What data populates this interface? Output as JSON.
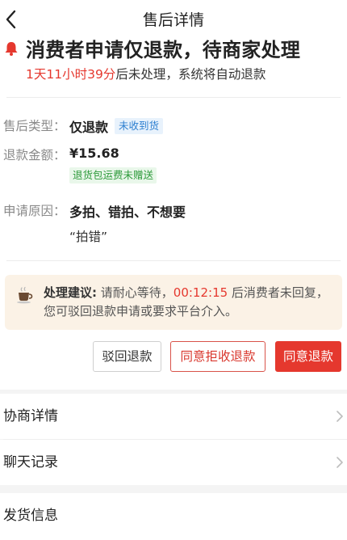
{
  "nav": {
    "title": "售后详情"
  },
  "status": {
    "title": "消费者申请仅退款，待商家处理",
    "countdown": "1天11小时39分",
    "suffix": "后未处理，系统将自动退款"
  },
  "info": {
    "type_label": "售后类型：",
    "type_value": "仅退款",
    "type_tag": "未收到货",
    "amount_label": "退款金额：",
    "amount_value": "¥15.68",
    "amount_tag": "退货包运费未赠送",
    "reason_label": "申请原因：",
    "reason_value": "多拍、错拍、不想要",
    "reason_note": "“拍错”"
  },
  "advice": {
    "label": "处理建议:",
    "text_before": " 请耐心等待，",
    "time": "00:12:15",
    "text_after": " 后消费者未回复，您可驳回退款申请或要求平台介入。"
  },
  "actions": {
    "reject": "驳回退款",
    "refuse_receipt": "同意拒收退款",
    "agree": "同意退款"
  },
  "sections": {
    "negotiation": "协商详情",
    "chat": "聊天记录",
    "shipping": "发货信息"
  },
  "colors": {
    "accent": "#e5382e",
    "tag_blue": "#2d7fd0",
    "tag_green": "#2d9a3a",
    "advice_bg": "#fbf2e6"
  },
  "icons": {
    "back": "chevron-left-icon",
    "status": "bell-icon",
    "advice": "coffee-cup-icon",
    "row": "chevron-right-icon"
  }
}
